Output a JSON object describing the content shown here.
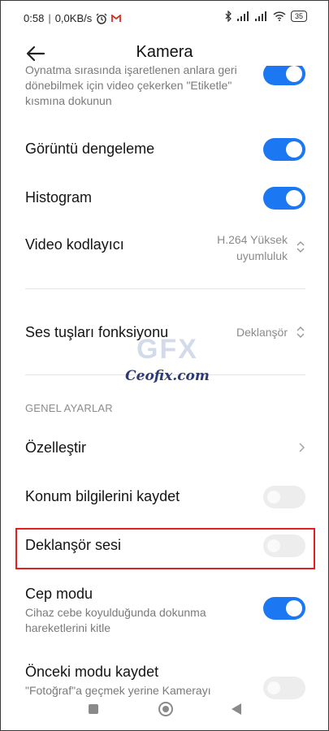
{
  "status_bar": {
    "time": "0:58",
    "net_speed": "0,0KB/s",
    "battery": "35",
    "icons": [
      "alarm-icon",
      "gmail-icon",
      "bluetooth-icon",
      "signal-icon",
      "signal-icon",
      "wifi-icon",
      "battery-icon"
    ]
  },
  "header": {
    "title": "Kamera",
    "back_icon": "arrow-left-icon"
  },
  "items": {
    "top_partial_sub": [
      "Oynatma sırasında işaretlenen anlara geri",
      "dönebilmek için video çekerken \"Etiketle\"",
      "kısmına dokunun"
    ],
    "stabilization": {
      "label": "Görüntü dengeleme",
      "on": true
    },
    "histogram": {
      "label": "Histogram",
      "on": true
    },
    "video_codec": {
      "label": "Video kodlayıcı",
      "value_line1": "H.264 Yüksek",
      "value_line2": "uyumluluk"
    },
    "volume_keys": {
      "label": "Ses tuşları fonksiyonu",
      "value": "Deklanşör"
    },
    "section_general": "GENEL AYARLAR",
    "customize": {
      "label": "Özelleştir"
    },
    "location": {
      "label": "Konum bilgilerini kaydet",
      "on": false
    },
    "shutter_sound": {
      "label": "Deklanşör sesi",
      "on": false
    },
    "pocket_mode": {
      "label": "Cep modu",
      "sub1": "Cihaz cebe koyulduğunda dokunma",
      "sub2": "hareketlerini kitle",
      "on": true
    },
    "save_prev_mode": {
      "label": "Önceki modu kaydet",
      "sub1": "\"Fotoğraf\"a geçmek yerine Kamerayı",
      "on": false
    }
  },
  "watermark": {
    "logo": "GFX",
    "text": "Ceofix.com"
  },
  "colors": {
    "accent": "#1b78f2",
    "highlight": "#e02020"
  }
}
